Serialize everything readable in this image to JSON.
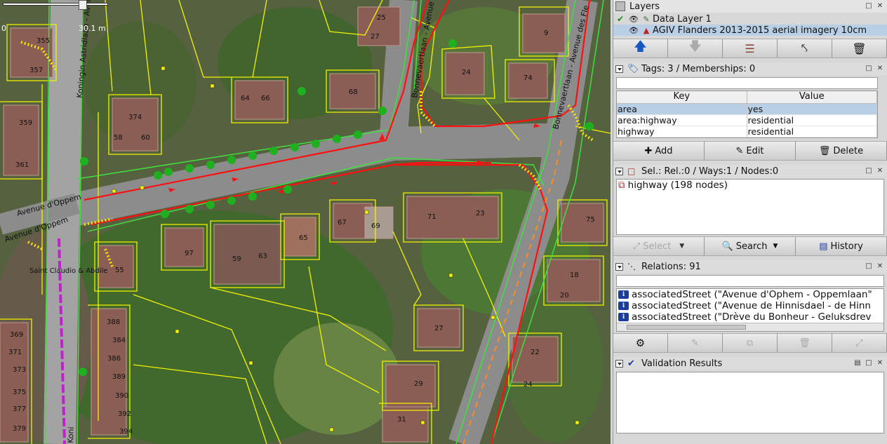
{
  "map": {
    "scale_left": "0",
    "scale_right": "30.1 m",
    "house_numbers": [
      "25",
      "27",
      "9",
      "24",
      "74",
      "68",
      "64",
      "66",
      "355",
      "357",
      "374",
      "359",
      "58",
      "60",
      "361",
      "67",
      "69",
      "65",
      "71",
      "23",
      "75",
      "18",
      "20",
      "97",
      "59",
      "63",
      "55",
      "388",
      "384",
      "386",
      "389",
      "390",
      "392",
      "394",
      "371",
      "373",
      "375",
      "377",
      "379",
      "27",
      "22",
      "24",
      "29",
      "31",
      "369"
    ],
    "street_labels": [
      "Koningin Astridlaan - Avenue",
      "Bonnevaertlaan - Avenue Bon",
      "Bonnevaertlaan - Avenue des Fle",
      "Avenue d'Oppem",
      "Avenue d'Oppem",
      "Koni",
      "Saint Claudio & Abdile"
    ]
  },
  "layers": {
    "title": "Layers",
    "items": [
      {
        "name": "Data Layer 1",
        "active": true
      },
      {
        "name": "AGIV Flanders 2013-2015 aerial imagery 10cm",
        "active": false
      }
    ],
    "buttons": [
      "move-up",
      "move-down",
      "activate",
      "merge",
      "delete"
    ]
  },
  "tags": {
    "title": "Tags: 3 / Memberships: 0",
    "col_key": "Key",
    "col_value": "Value",
    "rows": [
      {
        "key": "area",
        "value": "yes"
      },
      {
        "key": "area:highway",
        "value": "residential"
      },
      {
        "key": "highway",
        "value": "residential"
      }
    ],
    "add_label": "Add",
    "edit_label": "Edit",
    "delete_label": "Delete"
  },
  "selection": {
    "title": "Sel.: Rel.:0 / Ways:1 / Nodes:0",
    "items": [
      "highway (198 nodes)"
    ],
    "select_label": "Select",
    "search_label": "Search",
    "history_label": "History"
  },
  "relations": {
    "title": "Relations: 91",
    "items": [
      "associatedStreet (\"Avenue d'Ophem - Oppemlaan\"",
      "associatedStreet (\"Avenue de Hinnisdael - de Hinn",
      "associatedStreet (\"Drève du Bonheur - Geluksdrev"
    ]
  },
  "validation": {
    "title": "Validation Results"
  }
}
